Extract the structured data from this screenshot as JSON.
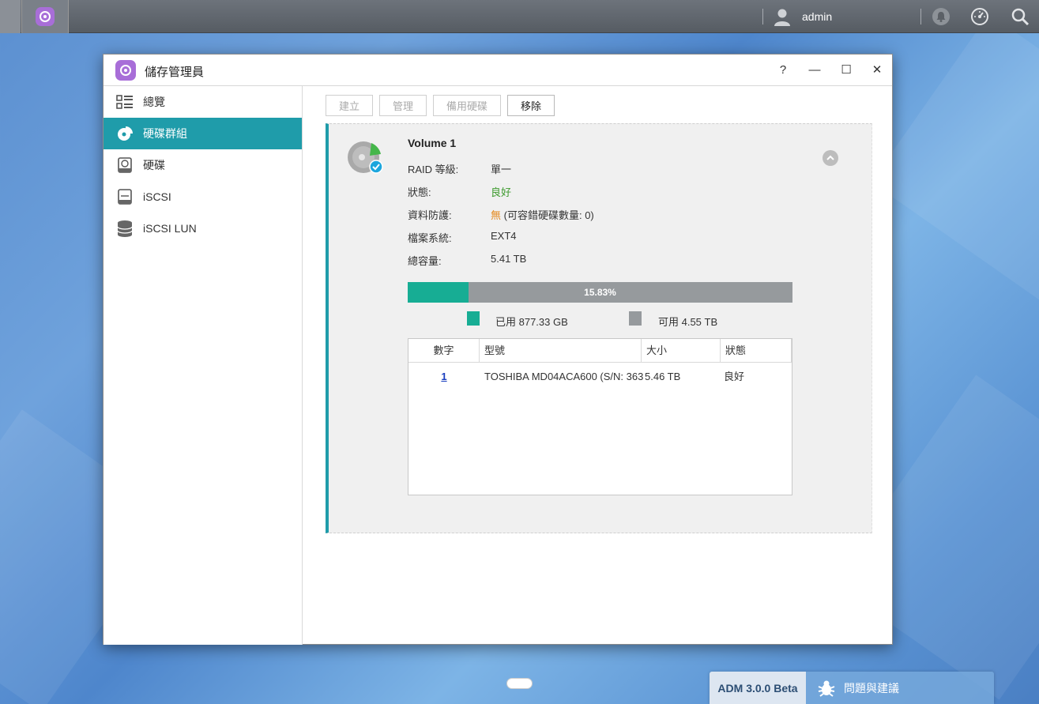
{
  "topbar": {
    "user": "admin"
  },
  "window": {
    "title": "儲存管理員",
    "help": "?",
    "minimize": "—",
    "maximize": "☐",
    "close": "✕"
  },
  "sidebar": {
    "items": [
      {
        "label": "總覽",
        "icon": "list-icon"
      },
      {
        "label": "硬碟群組",
        "icon": "pie-chart-icon"
      },
      {
        "label": "硬碟",
        "icon": "hard-disk-icon"
      },
      {
        "label": "iSCSI",
        "icon": "iscsi-icon"
      },
      {
        "label": "iSCSI LUN",
        "icon": "database-icon"
      }
    ],
    "active_index": 1
  },
  "toolbar": {
    "create": "建立",
    "manage": "管理",
    "spare": "備用硬碟",
    "remove": "移除"
  },
  "volume": {
    "name": "Volume 1",
    "raid_label": "RAID 等級:",
    "raid_value": "單一",
    "status_label": "狀態:",
    "status_value": "良好",
    "protection_label": "資料防護:",
    "protection_value": "無",
    "protection_extra": "(可容錯硬碟數量: 0)",
    "fs_label": "檔案系統:",
    "fs_value": "EXT4",
    "capacity_label": "總容量:",
    "capacity_value": "5.41 TB",
    "usage_percent": 15.83,
    "usage_text": "15.83%",
    "used_text": "已用 877.33 GB",
    "free_text": "可用 4.55 TB",
    "colors": {
      "used": "#17ad94",
      "free": "#969a9d",
      "accent": "#1f9caa"
    }
  },
  "disk_table": {
    "headers": [
      "數字",
      "型號",
      "大小",
      "狀態"
    ],
    "rows": [
      {
        "num": "1",
        "model": "TOSHIBA MD04ACA600 (S/N: 363...",
        "size": "5.46 TB",
        "status": "良好"
      }
    ]
  },
  "bottom": {
    "version": "ADM 3.0.0 Beta",
    "feedback": "問題與建議"
  }
}
